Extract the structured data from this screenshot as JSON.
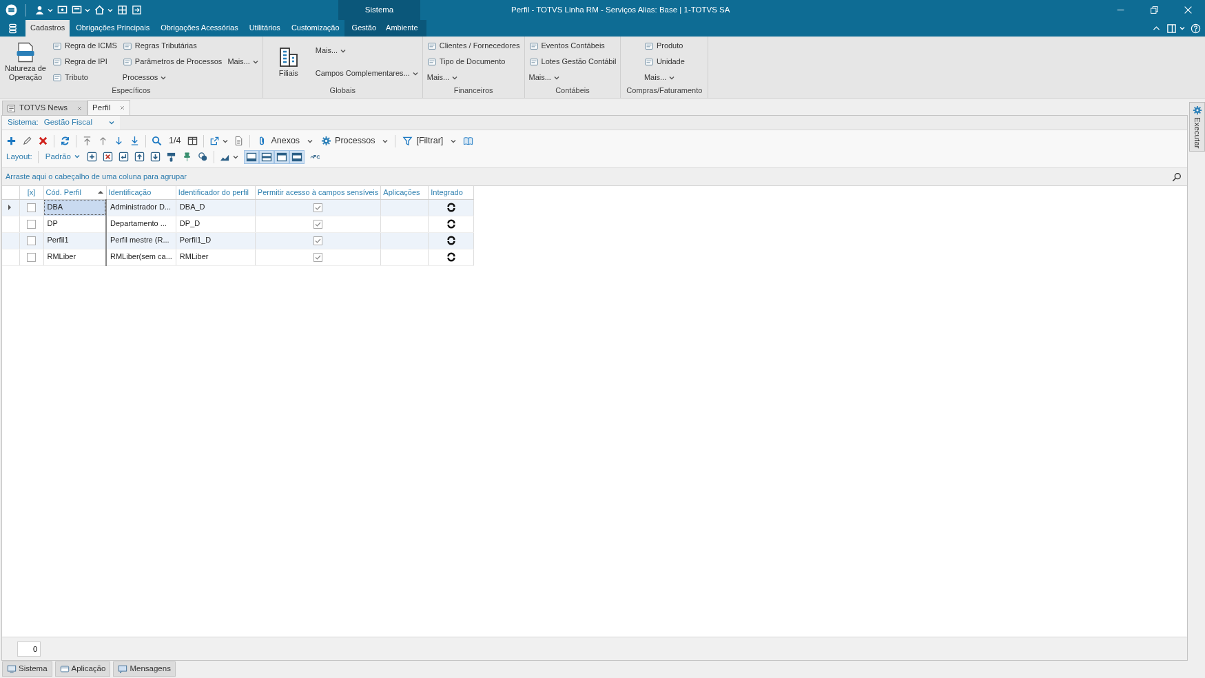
{
  "window": {
    "title": "Perfil - TOTVS Linha RM - Serviços  Alias: Base | 1-TOTVS SA",
    "context_label": "Sistema"
  },
  "ribbon_tabs": [
    {
      "label": "Cadastros",
      "selected": true,
      "context": false
    },
    {
      "label": "Obrigações Principais",
      "selected": false,
      "context": false
    },
    {
      "label": "Obrigações Acessórias",
      "selected": false,
      "context": false
    },
    {
      "label": "Utilitários",
      "selected": false,
      "context": false
    },
    {
      "label": "Customização",
      "selected": false,
      "context": false
    },
    {
      "label": "Gestão",
      "selected": false,
      "context": true
    },
    {
      "label": "Ambiente",
      "selected": false,
      "context": true
    }
  ],
  "ribbon_groups": [
    {
      "label": "Específicos",
      "columns": [
        [
          {
            "kind": "large",
            "label": "Natureza de Operação"
          }
        ],
        [
          {
            "kind": "small",
            "label": "Regra de ICMS"
          },
          {
            "kind": "small",
            "label": "Regra de IPI"
          },
          {
            "kind": "small",
            "label": "Tributo"
          }
        ],
        [
          {
            "kind": "small",
            "label": "Regras Tributárias"
          },
          {
            "kind": "small",
            "label": "Parâmetros de Processos"
          },
          {
            "kind": "dropdown",
            "label": "Processos"
          }
        ],
        [
          {
            "kind": "dropdown",
            "label": "Mais..."
          }
        ]
      ]
    },
    {
      "label": "Globais",
      "columns": [
        [
          {
            "kind": "large",
            "label": "Filiais"
          }
        ],
        [
          {
            "kind": "dropdown",
            "label": "Mais..."
          },
          {
            "kind": "dropdown",
            "label": "Campos Complementares..."
          }
        ]
      ]
    },
    {
      "label": "Financeiros",
      "columns": [
        [
          {
            "kind": "small",
            "label": "Clientes / Fornecedores"
          },
          {
            "kind": "small",
            "label": "Tipo de Documento"
          },
          {
            "kind": "dropdown",
            "label": "Mais..."
          }
        ]
      ]
    },
    {
      "label": "Contábeis",
      "columns": [
        [
          {
            "kind": "small",
            "label": "Eventos Contábeis"
          },
          {
            "kind": "small",
            "label": "Lotes Gestão Contábil"
          },
          {
            "kind": "dropdown",
            "label": "Mais..."
          }
        ]
      ]
    },
    {
      "label": "Compras/Faturamento",
      "columns": [
        [
          {
            "kind": "small",
            "label": "Produto"
          },
          {
            "kind": "small",
            "label": "Unidade"
          },
          {
            "kind": "dropdown",
            "label": "Mais..."
          }
        ]
      ]
    }
  ],
  "document_tabs": [
    {
      "label": "TOTVS News",
      "kind": "news",
      "selected": false
    },
    {
      "label": "Perfil",
      "kind": "form",
      "selected": true
    }
  ],
  "system_filter": {
    "label": "Sistema:",
    "value": "Gestão Fiscal"
  },
  "toolbar": {
    "page": "1/4",
    "attachments": "Anexos",
    "processes": "Processos",
    "filter": "[Filtrar]"
  },
  "layout_toolbar": {
    "label": "Layout:",
    "preset": "Padrão"
  },
  "group_panel": {
    "hint": "Arraste aqui o cabeçalho de uma coluna para agrupar"
  },
  "table": {
    "columns": [
      {
        "label": "[x]",
        "sorted": false
      },
      {
        "label": "Cód. Perfil",
        "sorted": true
      },
      {
        "label": "Identificação",
        "sorted": false
      },
      {
        "label": "Identificador do perfil",
        "sorted": false
      },
      {
        "label": "Permitir acesso à campos sensíveis",
        "sorted": false
      },
      {
        "label": "Aplicações",
        "sorted": false
      },
      {
        "label": "Integrado",
        "sorted": false
      }
    ],
    "rows": [
      {
        "selected": true,
        "checked": false,
        "code": "DBA",
        "identification": "Administrador D...",
        "profile_id": "DBA_D",
        "sensitive_access": true,
        "integrated": true
      },
      {
        "selected": false,
        "checked": false,
        "code": "DP",
        "identification": "Departamento ...",
        "profile_id": "DP_D",
        "sensitive_access": true,
        "integrated": true
      },
      {
        "selected": false,
        "checked": false,
        "code": "Perfil1",
        "identification": "Perfil mestre (R...",
        "profile_id": "Perfil1_D",
        "sensitive_access": true,
        "integrated": true
      },
      {
        "selected": false,
        "checked": false,
        "code": "RMLiber",
        "identification": "RMLiber(sem ca...",
        "profile_id": "RMLiber",
        "sensitive_access": true,
        "integrated": true
      }
    ]
  },
  "footer": {
    "record_count": "0"
  },
  "status_tabs": [
    {
      "label": "Sistema"
    },
    {
      "label": "Aplicação"
    },
    {
      "label": "Mensagens"
    }
  ],
  "side_panel": {
    "label": "Executar"
  }
}
